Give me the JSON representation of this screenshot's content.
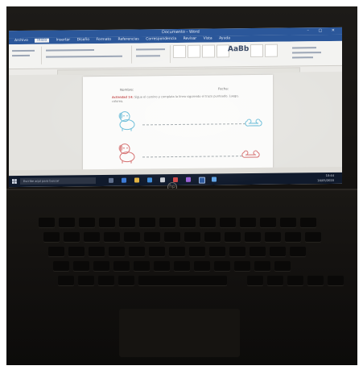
{
  "window": {
    "title": "Documento - Word",
    "controls": "–  ▢  ✕"
  },
  "ribbon": {
    "tabs": [
      "Archivo",
      "Inicio",
      "Insertar",
      "Diseño",
      "Formato",
      "Referencias",
      "Correspondencia",
      "Revisar",
      "Vista",
      "Ayuda"
    ],
    "active_tab_index": 1,
    "style_preview": "AaBb"
  },
  "document": {
    "nombre_label": "Nombre:",
    "fecha_label": "Fecha:",
    "activity_label": "Actividad 14:",
    "activity_text": "Sigue el camino y completa la línea siguiendo el trazo punteado. Luego, colorea."
  },
  "taskbar": {
    "search_placeholder": "Escribe aquí para buscar",
    "time": "10:44",
    "date": "16/05/2020"
  },
  "colors": {
    "accent": "#2b579a",
    "dog_blue": "#5fb8d6",
    "dog_red": "#d46a6a"
  },
  "icons": [
    "windows-start-icon",
    "dog-icon",
    "bone-icon",
    "hp-logo-icon"
  ]
}
